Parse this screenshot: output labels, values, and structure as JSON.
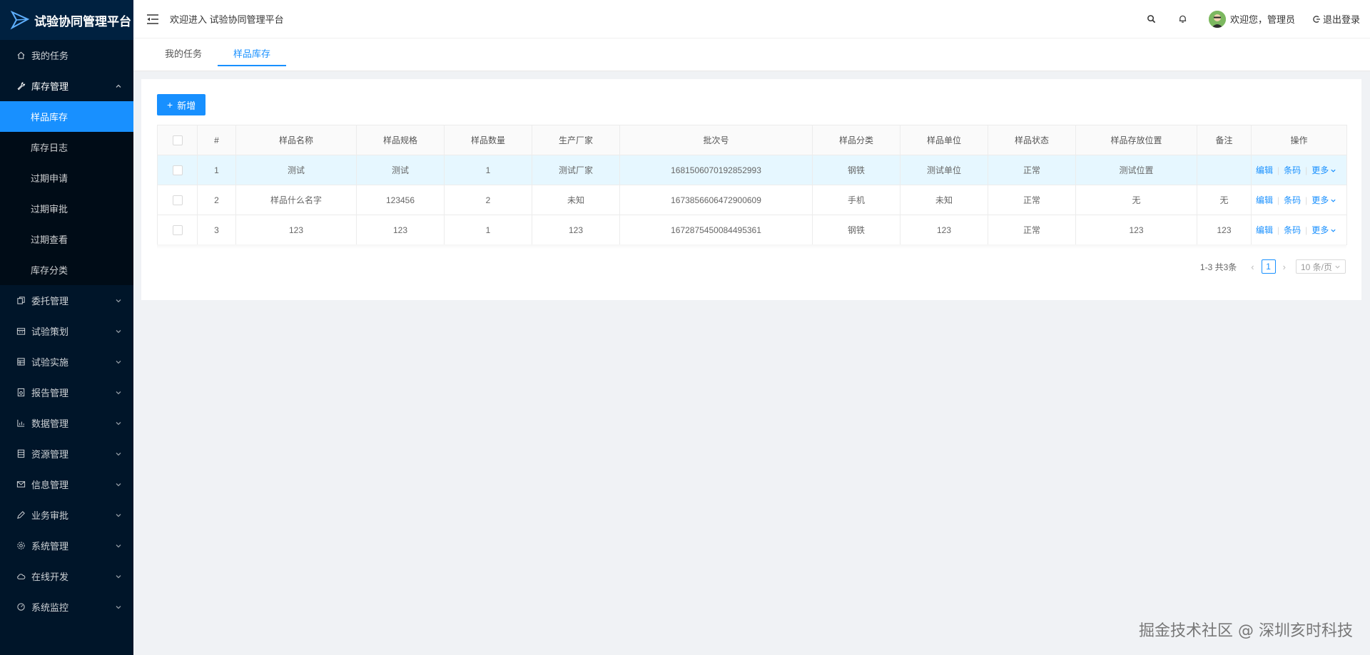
{
  "app": {
    "brand_title": "试验协同管理平台",
    "welcome": "欢迎进入 试验协同管理平台"
  },
  "sidebar": {
    "items": [
      {
        "label": "我的任务",
        "icon": "home-icon"
      },
      {
        "label": "库存管理",
        "icon": "wrench-icon",
        "open": true,
        "children": [
          "样品库存",
          "库存日志",
          "过期申请",
          "过期审批",
          "过期查看",
          "库存分类"
        ]
      },
      {
        "label": "委托管理",
        "icon": "copy-icon"
      },
      {
        "label": "试验策划",
        "icon": "calendar-icon"
      },
      {
        "label": "试验实施",
        "icon": "grid-icon"
      },
      {
        "label": "报告管理",
        "icon": "report-icon"
      },
      {
        "label": "数据管理",
        "icon": "bar-chart-icon"
      },
      {
        "label": "资源管理",
        "icon": "list-icon"
      },
      {
        "label": "信息管理",
        "icon": "mail-icon"
      },
      {
        "label": "业务审批",
        "icon": "pen-icon"
      },
      {
        "label": "系统管理",
        "icon": "gear-icon"
      },
      {
        "label": "在线开发",
        "icon": "cloud-icon"
      },
      {
        "label": "系统监控",
        "icon": "dashboard-icon"
      }
    ],
    "active_sub": "样品库存"
  },
  "header": {
    "user_greeting": "欢迎您，管理员",
    "logout_label": "退出登录"
  },
  "tabs": [
    {
      "label": "我的任务",
      "active": false
    },
    {
      "label": "样品库存",
      "active": true
    }
  ],
  "toolbar": {
    "add_label": "新增"
  },
  "table": {
    "columns": [
      "#",
      "样品名称",
      "样品规格",
      "样品数量",
      "生产厂家",
      "批次号",
      "样品分类",
      "样品单位",
      "样品状态",
      "样品存放位置",
      "备注",
      "操作"
    ],
    "rows": [
      {
        "no": "1",
        "name": "测试",
        "spec": "测试",
        "qty": "1",
        "maker": "测试厂家",
        "batch": "1681506070192852993",
        "category": "钢铁",
        "unit": "测试单位",
        "status": "正常",
        "location": "测试位置",
        "remark": ""
      },
      {
        "no": "2",
        "name": "样品什么名字",
        "spec": "123456",
        "qty": "2",
        "maker": "未知",
        "batch": "1673856606472900609",
        "category": "手机",
        "unit": "未知",
        "status": "正常",
        "location": "无",
        "remark": "无"
      },
      {
        "no": "3",
        "name": "123",
        "spec": "123",
        "qty": "1",
        "maker": "123",
        "batch": "1672875450084495361",
        "category": "钢铁",
        "unit": "123",
        "status": "正常",
        "location": "123",
        "remark": "123"
      }
    ],
    "actions": {
      "edit": "编辑",
      "barcode": "条码",
      "more": "更多"
    }
  },
  "pagination": {
    "total_text": "1-3 共3条",
    "current_page": "1",
    "page_size": "10 条/页"
  },
  "watermark": "掘金技术社区 @ 深圳亥时科技"
}
